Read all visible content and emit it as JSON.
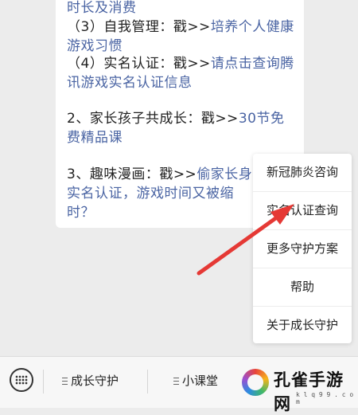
{
  "message": {
    "line_top": "时长及消费",
    "item_self": {
      "prefix": "（3）自我管理：戳>>",
      "link": "培养个人健康游戏习惯"
    },
    "item_realname": {
      "prefix": "（4）实名认证：戳>>",
      "link": "请点击查询腾讯游戏实名认证信息"
    },
    "item_parent": {
      "prefix": "2、家长孩子共成长：戳>>",
      "link": "30节免费精品课"
    },
    "item_comic": {
      "prefix": "3、趣味漫画：戳>>",
      "link_visible": "偷家长身",
      "link_cont": "实名认证，游戏时间又被缩",
      "suffix": "时？"
    }
  },
  "popup_menu": {
    "items": [
      "新冠肺炎咨询",
      "实名认证查询",
      "更多守护方案",
      "帮助",
      "关于成长守护"
    ]
  },
  "bottom_bar": {
    "tabs": [
      "成长守护",
      "小课堂"
    ]
  },
  "watermark": {
    "title": "孔雀手游网",
    "sub": "k l q 9 9 . c o m"
  },
  "colors": {
    "link": "#4a64a3",
    "arrow": "#e53935"
  }
}
